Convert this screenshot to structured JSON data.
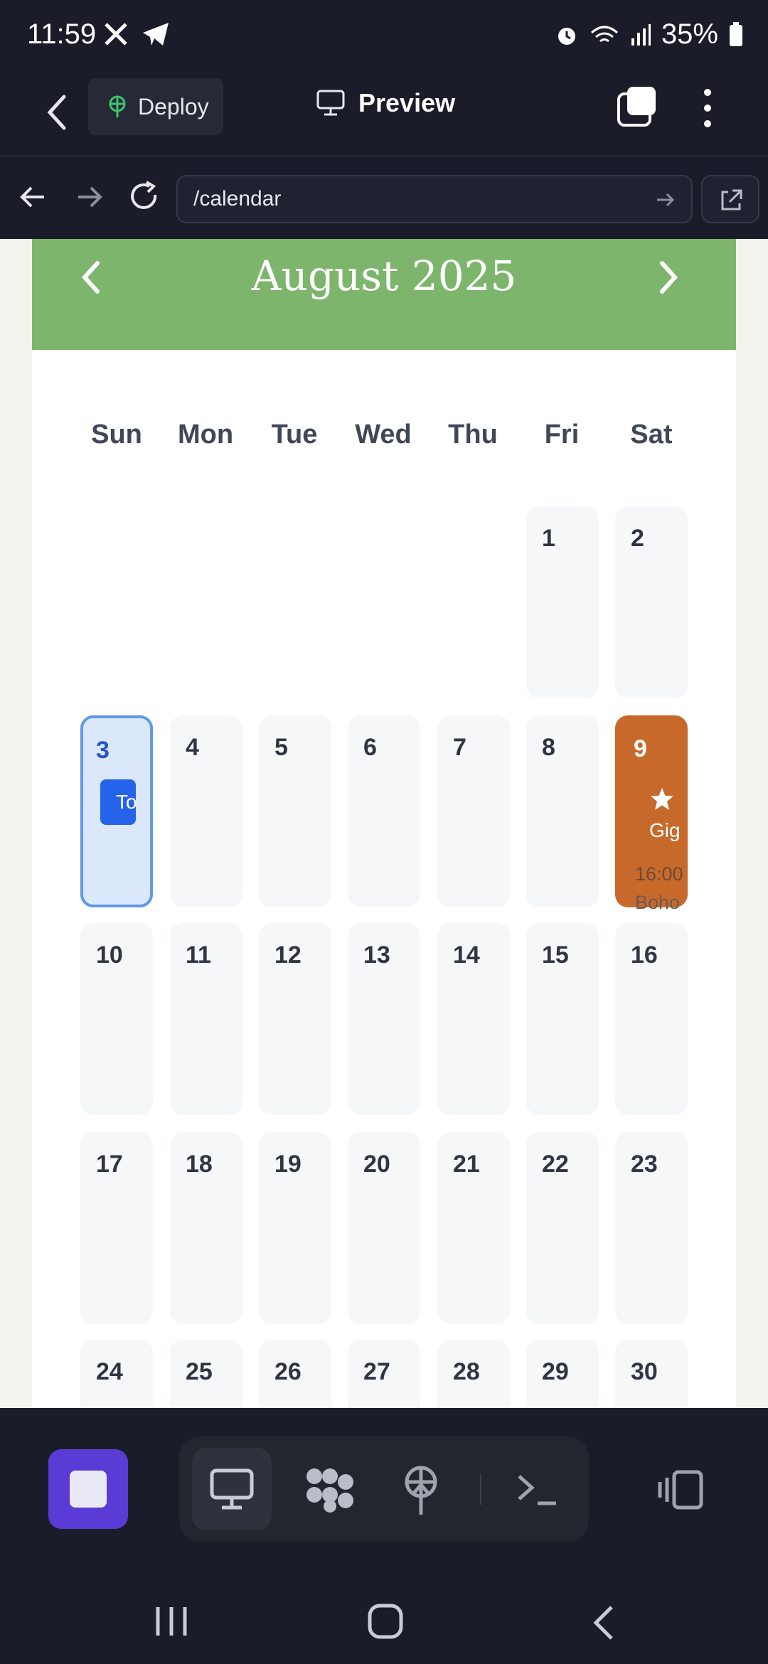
{
  "status_bar": {
    "time": "11:59",
    "battery": "35%"
  },
  "app_bar": {
    "deploy_label": "Deploy",
    "preview_label": "Preview"
  },
  "url_bar": {
    "url": "/calendar"
  },
  "calendar": {
    "month_title": "August 2025",
    "weekdays": [
      "Sun",
      "Mon",
      "Tue",
      "Wed",
      "Thu",
      "Fri",
      "Sat"
    ],
    "days": [
      "1",
      "2",
      "3",
      "4",
      "5",
      "6",
      "7",
      "8",
      "9",
      "10",
      "11",
      "12",
      "13",
      "14",
      "15",
      "16",
      "17",
      "18",
      "19",
      "20",
      "21",
      "22",
      "23",
      "24",
      "25",
      "26",
      "27",
      "28",
      "29",
      "30"
    ],
    "today_label": "Today",
    "event": {
      "title": "Gig",
      "time": "16:00",
      "venue": "Boho"
    }
  },
  "colors": {
    "header_green": "#7cb56b",
    "event_orange": "#c7692b",
    "today_blue": "#2563eb",
    "accent_purple": "#5b3bd6"
  },
  "icons": [
    "back-arrow-icon",
    "deploy-icon",
    "monitor-icon",
    "tabs-icon",
    "more-vert-icon",
    "nav-back-icon",
    "nav-forward-icon",
    "reload-icon",
    "go-arrow-icon",
    "external-link-icon",
    "chevron-left-icon",
    "chevron-right-icon",
    "star-icon",
    "stop-icon",
    "preview-monitor-icon",
    "blocks-icon",
    "deploy-tree-icon",
    "terminal-icon",
    "split-view-icon"
  ]
}
